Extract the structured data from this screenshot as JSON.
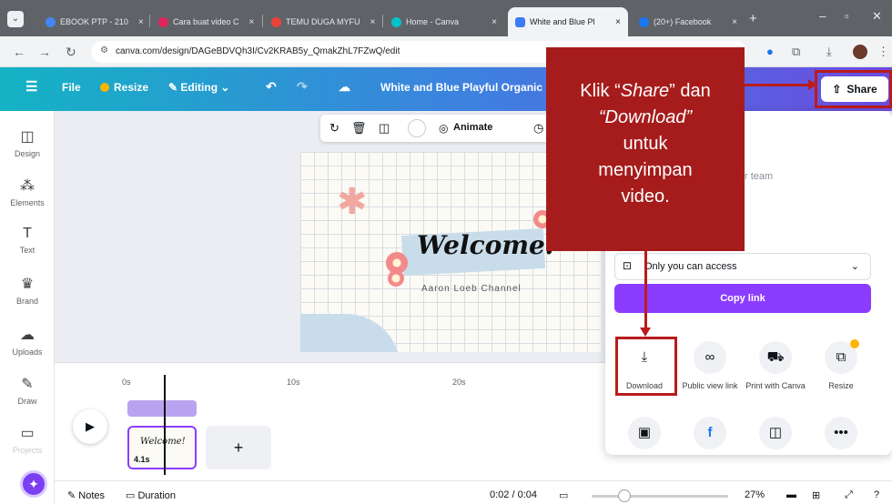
{
  "browser": {
    "tabs": [
      {
        "title": "EBOOK PTP - 210",
        "favicon_color": "#4285f4"
      },
      {
        "title": "Cara buat video C",
        "favicon_color": "#e0245e"
      },
      {
        "title": "TEMU DUGA MYFU",
        "favicon_color": "#ea4335"
      },
      {
        "title": "Home - Canva",
        "favicon_color": "#00c4cc"
      },
      {
        "title": "White and Blue Pl",
        "favicon_color": "#3d7bf7"
      },
      {
        "title": "(20+) Facebook",
        "favicon_color": "#1877f2"
      }
    ],
    "tab_close": "×",
    "new_tab": "+",
    "window_controls": {
      "minimize": "–",
      "maximize": "▫",
      "close": "✕"
    },
    "url": "canva.com/design/DAGeBDVQh3I/Cv2KRAB5y_QmakZhL7FZwQ/edit"
  },
  "canva_header": {
    "menu_icon": "☰",
    "file_label": "File",
    "resize_label": "Resize",
    "editing_label": "Editing",
    "title": "White and Blue Playful Organic Cha",
    "share_label": "Share"
  },
  "sidebar": {
    "items": [
      {
        "label": "Design",
        "icon": "design-icon"
      },
      {
        "label": "Elements",
        "icon": "elements-icon"
      },
      {
        "label": "Text",
        "icon": "text-icon"
      },
      {
        "label": "Brand",
        "icon": "brand-icon"
      },
      {
        "label": "Uploads",
        "icon": "uploads-icon"
      },
      {
        "label": "Draw",
        "icon": "draw-icon"
      },
      {
        "label": "Projects",
        "icon": "projects-icon"
      }
    ]
  },
  "toolbar": {
    "animate_label": "Animate"
  },
  "canvas": {
    "title": "Welcome!",
    "subtitle": "Aaron Loeb Channel"
  },
  "timeline": {
    "ticks": [
      "0s",
      "10s",
      "20s"
    ],
    "clip_duration": "4.1s",
    "clip_preview_text": "Welcome!"
  },
  "bottom_bar": {
    "notes_label": "Notes",
    "duration_label": "Duration",
    "time_readout": "0:02 / 0:04",
    "zoom_level": "27%"
  },
  "share_panel": {
    "team_placeholder": "r team",
    "access_label": "Only you can access",
    "copy_link_label": "Copy link",
    "options": [
      {
        "label": "Download",
        "icon": "download-icon"
      },
      {
        "label": "Public view link",
        "icon": "link-icon"
      },
      {
        "label": "Print with Canva",
        "icon": "print-truck-icon"
      },
      {
        "label": "Resize",
        "icon": "resize-icon"
      }
    ],
    "second_row_icons": [
      "canva-app-icon",
      "facebook-icon",
      "template-icon",
      "more-icon"
    ]
  },
  "annotation": {
    "line1_pre": "Klik “",
    "line1_em": "Share",
    "line1_post": "” dan",
    "line2": "“Download”",
    "line3": "untuk",
    "line4": "menyimpan",
    "line5": "video."
  },
  "colors": {
    "accent_purple": "#8b3dff",
    "annotation_red": "#a61c1c",
    "header_gradient_start": "#14b3c4",
    "header_gradient_end": "#6d4be0"
  }
}
